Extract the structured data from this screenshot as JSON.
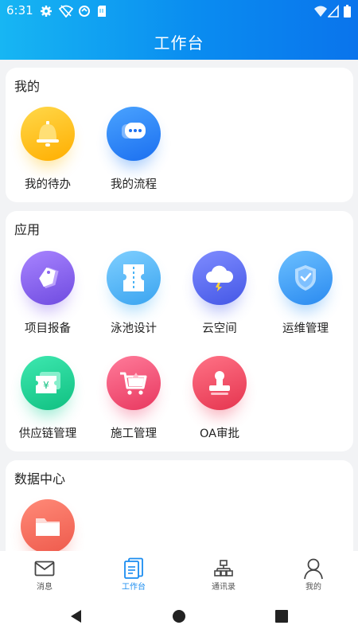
{
  "status_bar": {
    "time": "6:31"
  },
  "header": {
    "title": "工作台"
  },
  "mine": {
    "title": "我的",
    "items": [
      {
        "label": "我的待办",
        "icon": "bell-icon",
        "color": "#ffc21a"
      },
      {
        "label": "我的流程",
        "icon": "chat-bubble-icon",
        "color": "#2f86f6"
      }
    ]
  },
  "apps": {
    "title": "应用",
    "items": [
      {
        "label": "项目报备",
        "icon": "tag-icon",
        "color": "#8b66ee"
      },
      {
        "label": "泳池设计",
        "icon": "ticket-icon",
        "color": "#49b3f5"
      },
      {
        "label": "云空间",
        "icon": "cloud-icon",
        "color": "#5b6cf0"
      },
      {
        "label": "运维管理",
        "icon": "shield-icon",
        "color": "#3d9cf5"
      },
      {
        "label": "供应链管理",
        "icon": "yen-ticket-icon",
        "color": "#1ed39a"
      },
      {
        "label": "施工管理",
        "icon": "cart-icon",
        "color": "#f0527a"
      },
      {
        "label": "OA审批",
        "icon": "stamp-icon",
        "color": "#f0506a"
      }
    ]
  },
  "data_center": {
    "title": "数据中心",
    "items": [
      {
        "label": "",
        "icon": "folder-icon",
        "color": "#f36a5e"
      }
    ]
  },
  "tabbar": {
    "items": [
      {
        "label": "消息",
        "icon": "mail-icon"
      },
      {
        "label": "工作台",
        "icon": "document-icon"
      },
      {
        "label": "通讯录",
        "icon": "org-chart-icon"
      },
      {
        "label": "我的",
        "icon": "person-icon"
      }
    ],
    "active_color": "#1a8cf0"
  }
}
